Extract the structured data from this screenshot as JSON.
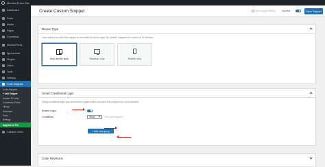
{
  "adminbar": {
    "site_name": "MemberPress Site"
  },
  "sidebar": {
    "items_top": [
      {
        "label": "Dashboard"
      },
      {
        "label": "Posts"
      },
      {
        "label": "Media"
      },
      {
        "label": "Pages"
      },
      {
        "label": "Comments"
      },
      {
        "label": "MemberPress"
      },
      {
        "label": "Appearance"
      },
      {
        "label": "Plugins"
      },
      {
        "label": "Users"
      },
      {
        "label": "Tools"
      },
      {
        "label": "Settings"
      }
    ],
    "active": {
      "label": "Code Snippets"
    },
    "submenu": [
      {
        "label": "Code Snippets"
      },
      {
        "label": "+ Add Snippet"
      },
      {
        "label": "Header & Footer"
      },
      {
        "label": "Conversion Pixels"
      },
      {
        "label": "Library"
      },
      {
        "label": "Generator"
      },
      {
        "label": "Tools"
      },
      {
        "label": "Settings"
      },
      {
        "label": "Upgrade to Pro"
      }
    ],
    "collapse_label": "Collapse menu"
  },
  "header": {
    "title": "Create Custom Snippet",
    "search_library": "Use snippet library",
    "inactive_label": "Inactive",
    "save_label": "Save Snippet"
  },
  "device_panel": {
    "title": "Device Type",
    "description": "Limit where you want this snippet to be loaded by device type. By default, snippets are loaded on all devices.",
    "options": [
      {
        "label": "Any device type",
        "icon": "devices-icon",
        "selected": true
      },
      {
        "label": "Desktop only",
        "icon": "desktop-icon",
        "selected": false
      },
      {
        "label": "Mobile only",
        "icon": "mobile-icon",
        "selected": false
      }
    ]
  },
  "logic_panel": {
    "title": "Smart Conditional Logic",
    "description": "Using conditional logic you can limit the pages where you want the snippet to be auto-inserted.",
    "enable_label": "Enable Logic",
    "enabled": true,
    "conditions_label": "Conditions",
    "show_select": "Show",
    "conditions_hint": "This code snippet if",
    "add_group_label": "+ Add new group"
  },
  "revisions_panel": {
    "title": "Code Revisions"
  },
  "colors": {
    "accent": "#2271b1",
    "sidebar": "#1d2327",
    "annotation": "#e01b1b",
    "upgrade": "#09a138"
  }
}
